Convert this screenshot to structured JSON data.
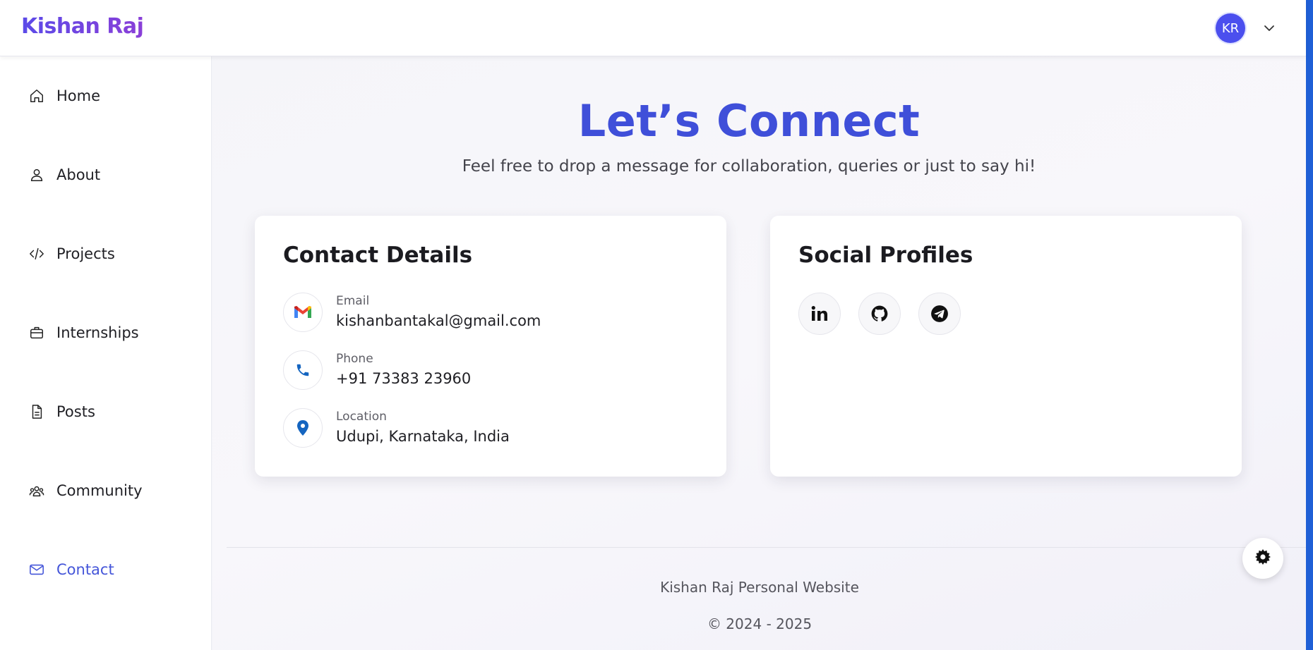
{
  "header": {
    "brand": "Kishan Raj",
    "avatar_initials": "KR"
  },
  "sidebar": {
    "items": [
      {
        "label": "Home",
        "icon": "home-icon"
      },
      {
        "label": "About",
        "icon": "user-icon"
      },
      {
        "label": "Projects",
        "icon": "code-icon"
      },
      {
        "label": "Internships",
        "icon": "briefcase-icon"
      },
      {
        "label": "Posts",
        "icon": "document-icon"
      },
      {
        "label": "Community",
        "icon": "users-icon"
      },
      {
        "label": "Contact",
        "icon": "mail-icon",
        "active": true
      }
    ]
  },
  "hero": {
    "title": "Let’s Connect",
    "subtitle": "Feel free to drop a message for collaboration, queries or just to say hi!"
  },
  "contact_card": {
    "title": "Contact Details",
    "items": [
      {
        "label": "Email",
        "value": "kishanbantakal@gmail.com",
        "icon": "gmail-icon"
      },
      {
        "label": "Phone",
        "value": "+91 73383 23960",
        "icon": "phone-icon"
      },
      {
        "label": "Location",
        "value": "Udupi, Karnataka, India",
        "icon": "location-pin-icon"
      }
    ]
  },
  "social_card": {
    "title": "Social Profiles",
    "links": [
      {
        "icon": "linkedin-icon"
      },
      {
        "icon": "github-icon"
      },
      {
        "icon": "telegram-icon"
      }
    ]
  },
  "footer": {
    "name": "Kishan Raj Personal Website",
    "copyright": "© 2024 - 2025"
  },
  "colors": {
    "accent": "#3f4fd9",
    "active_nav": "#4556d9",
    "avatar_bg": "#4b4fee",
    "right_edge": "#1f5fd6"
  }
}
